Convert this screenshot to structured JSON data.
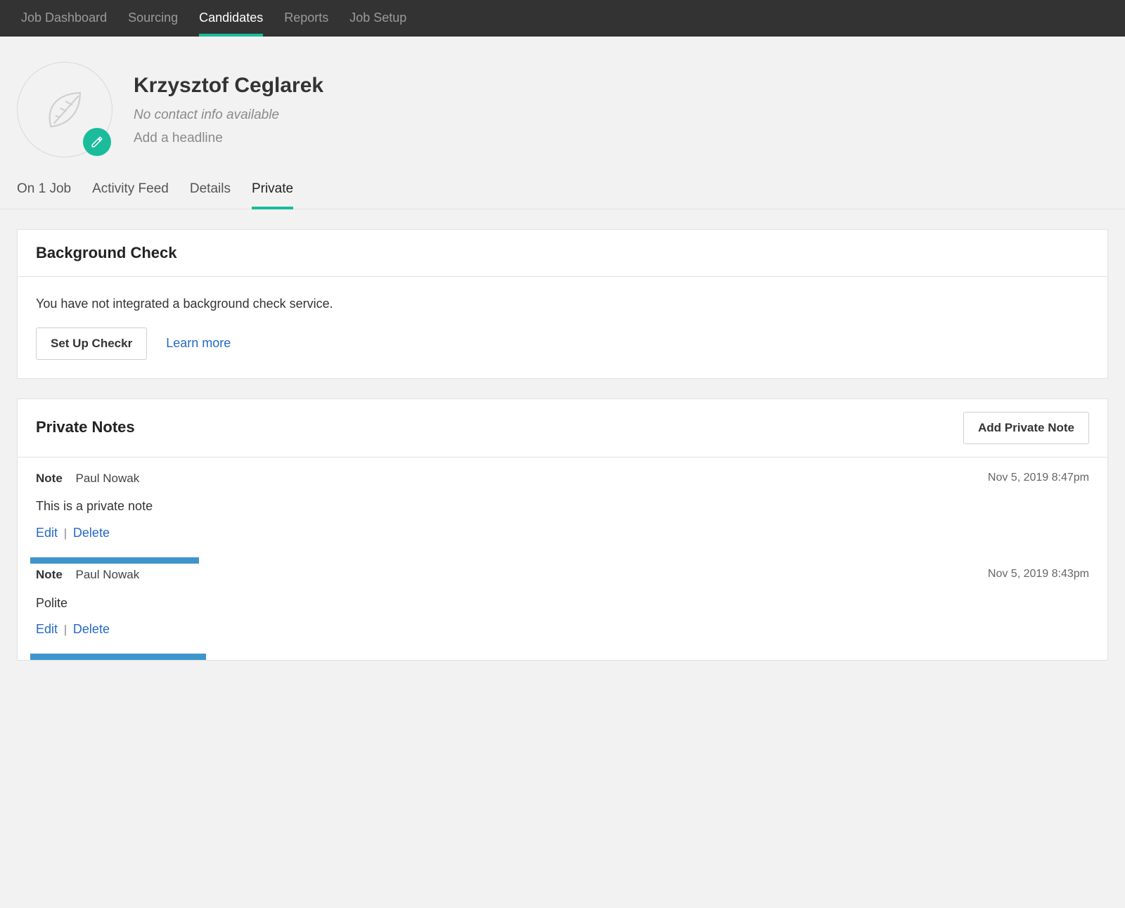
{
  "nav": {
    "items": [
      {
        "label": "Job Dashboard",
        "active": false
      },
      {
        "label": "Sourcing",
        "active": false
      },
      {
        "label": "Candidates",
        "active": true
      },
      {
        "label": "Reports",
        "active": false
      },
      {
        "label": "Job Setup",
        "active": false
      }
    ]
  },
  "candidate": {
    "name": "Krzysztof Ceglarek",
    "contact_info_text": "No contact info available",
    "headline_placeholder": "Add a headline"
  },
  "sub_tabs": [
    {
      "label": "On 1 Job",
      "active": false
    },
    {
      "label": "Activity Feed",
      "active": false
    },
    {
      "label": "Details",
      "active": false
    },
    {
      "label": "Private",
      "active": true
    }
  ],
  "background_check": {
    "title": "Background Check",
    "message": "You have not integrated a background check service.",
    "setup_btn": "Set Up Checkr",
    "learn_more": "Learn more"
  },
  "private_notes": {
    "title": "Private Notes",
    "add_btn": "Add Private Note",
    "note_label": "Note",
    "edit_label": "Edit",
    "delete_label": "Delete",
    "notes": [
      {
        "author": "Paul Nowak",
        "timestamp": "Nov 5, 2019 8:47pm",
        "body": "This is a private note"
      },
      {
        "author": "Paul Nowak",
        "timestamp": "Nov 5, 2019 8:43pm",
        "body": "Polite"
      }
    ]
  }
}
